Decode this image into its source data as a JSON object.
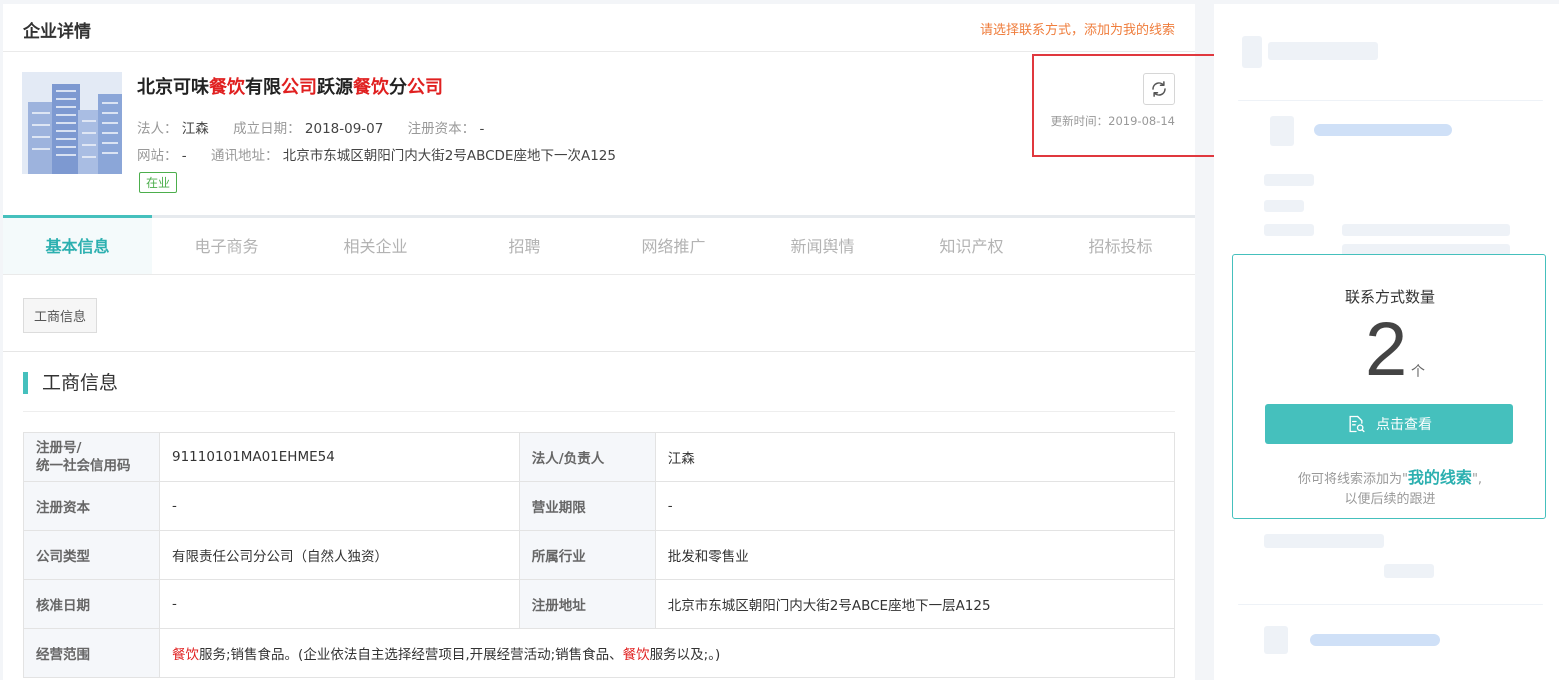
{
  "header": {
    "title": "企业详情",
    "action_link": "请选择联系方式，添加为我的线索"
  },
  "company": {
    "name_parts": [
      "北京可味",
      "餐饮",
      "有限",
      "公司",
      "跃源",
      "餐饮",
      "分",
      "公司"
    ],
    "legal_label": "法人：",
    "legal_value": "江森",
    "founded_label": "成立日期：",
    "founded_value": "2018-09-07",
    "capital_label": "注册资本：",
    "capital_value": "-",
    "website_label": "网站：",
    "website_value": "-",
    "address_label": "通讯地址：",
    "address_value": "北京市东城区朝阳门内大街2号ABCDE座地下一次A125",
    "status_tag": "在业",
    "update_label": "更新时间：2019-08-14"
  },
  "tabs": [
    {
      "label": "基本信息",
      "active": true
    },
    {
      "label": "电子商务",
      "active": false
    },
    {
      "label": "相关企业",
      "active": false
    },
    {
      "label": "招聘",
      "active": false
    },
    {
      "label": "网络推广",
      "active": false
    },
    {
      "label": "新闻舆情",
      "active": false
    },
    {
      "label": "知识产权",
      "active": false
    },
    {
      "label": "招标投标",
      "active": false
    }
  ],
  "subtab": "工商信息",
  "section_title": "工商信息",
  "table": {
    "r1": {
      "k1a": "注册号/",
      "k1b": "统一社会信用码",
      "v1": "91110101MA01EHME54",
      "k2": "法人/负责人",
      "v2": "江森"
    },
    "r2": {
      "k1": "注册资本",
      "v1": "-",
      "k2": "营业期限",
      "v2": "-"
    },
    "r3": {
      "k1": "公司类型",
      "v1": "有限责任公司分公司（自然人独资）",
      "k2": "所属行业",
      "v2": "批发和零售业"
    },
    "r4": {
      "k1": "核准日期",
      "v1": "-",
      "k2": "注册地址",
      "v2": "北京市东城区朝阳门内大街2号ABCE座地下一层A125"
    },
    "r5": {
      "k1": "经营范围",
      "s1": "餐饮",
      "s2": "服务;销售食品。(企业依法自主选择经营项目,开展经营活动;销售食品、",
      "s3": "餐饮",
      "s4": "服务以及;。)"
    }
  },
  "contact_card": {
    "title": "联系方式数量",
    "count": "2",
    "unit": "个",
    "button_label": "点击查看",
    "note_prefix": "你可将线索添加为\"",
    "note_link": "我的线索",
    "note_suffix": "\",",
    "note_line2": "以便后续的跟进"
  },
  "colors": {
    "accent": "#45c0bd",
    "highlight": "#e02020",
    "orange_link": "#ef7d3c",
    "annotation_box": "#e0383e"
  }
}
